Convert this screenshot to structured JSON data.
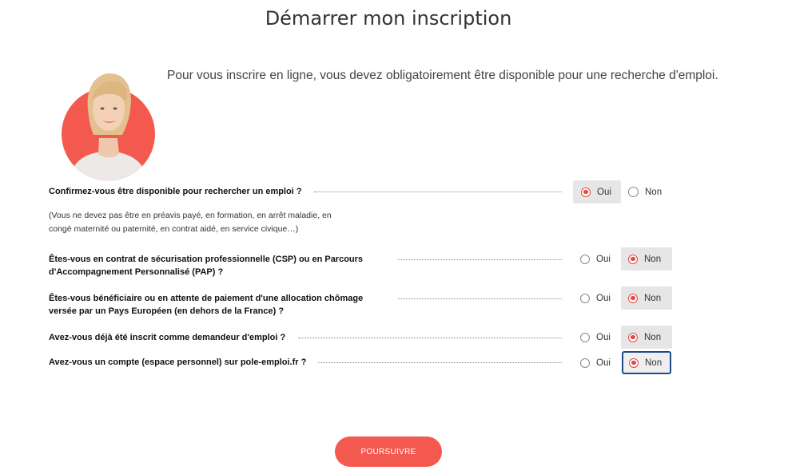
{
  "page": {
    "title": "Démarrer mon inscription",
    "intro": "Pour vous inscrire en ligne, vous devez obligatoirement être disponible pour une recherche d'emploi."
  },
  "questions": [
    {
      "label": "Confirmez-vous être disponible pour rechercher un emploi ?",
      "selected": "Oui",
      "note": [
        "(Vous ne devez pas être en préavis payé, en formation, en arrêt maladie, en",
        "congé maternité ou paternité, en contrat aidé, en service civique…)"
      ]
    },
    {
      "label_lines": [
        "Êtes-vous en contrat de sécurisation professionnelle (CSP) ou en Parcours",
        "d'Accompagnement Personnalisé (PAP) ?"
      ],
      "selected": "Non"
    },
    {
      "label_lines": [
        "Êtes-vous bénéficiaire ou en attente de paiement d'une allocation chômage",
        "versée par un Pays Européen (en dehors de la France) ?"
      ],
      "selected": "Non"
    },
    {
      "label": "Avez-vous déjà été inscrit comme demandeur d'emploi ?",
      "selected": "Non"
    },
    {
      "label": "Avez-vous un compte (espace personnel) sur pole-emploi.fr ?",
      "selected": "Non"
    }
  ],
  "options": {
    "yes": "Oui",
    "no": "Non"
  },
  "submit": {
    "label": "POURSUIVRE"
  },
  "colors": {
    "accent": "#f4594f",
    "radio": "#e8463e",
    "focus": "#1f4a8a"
  }
}
